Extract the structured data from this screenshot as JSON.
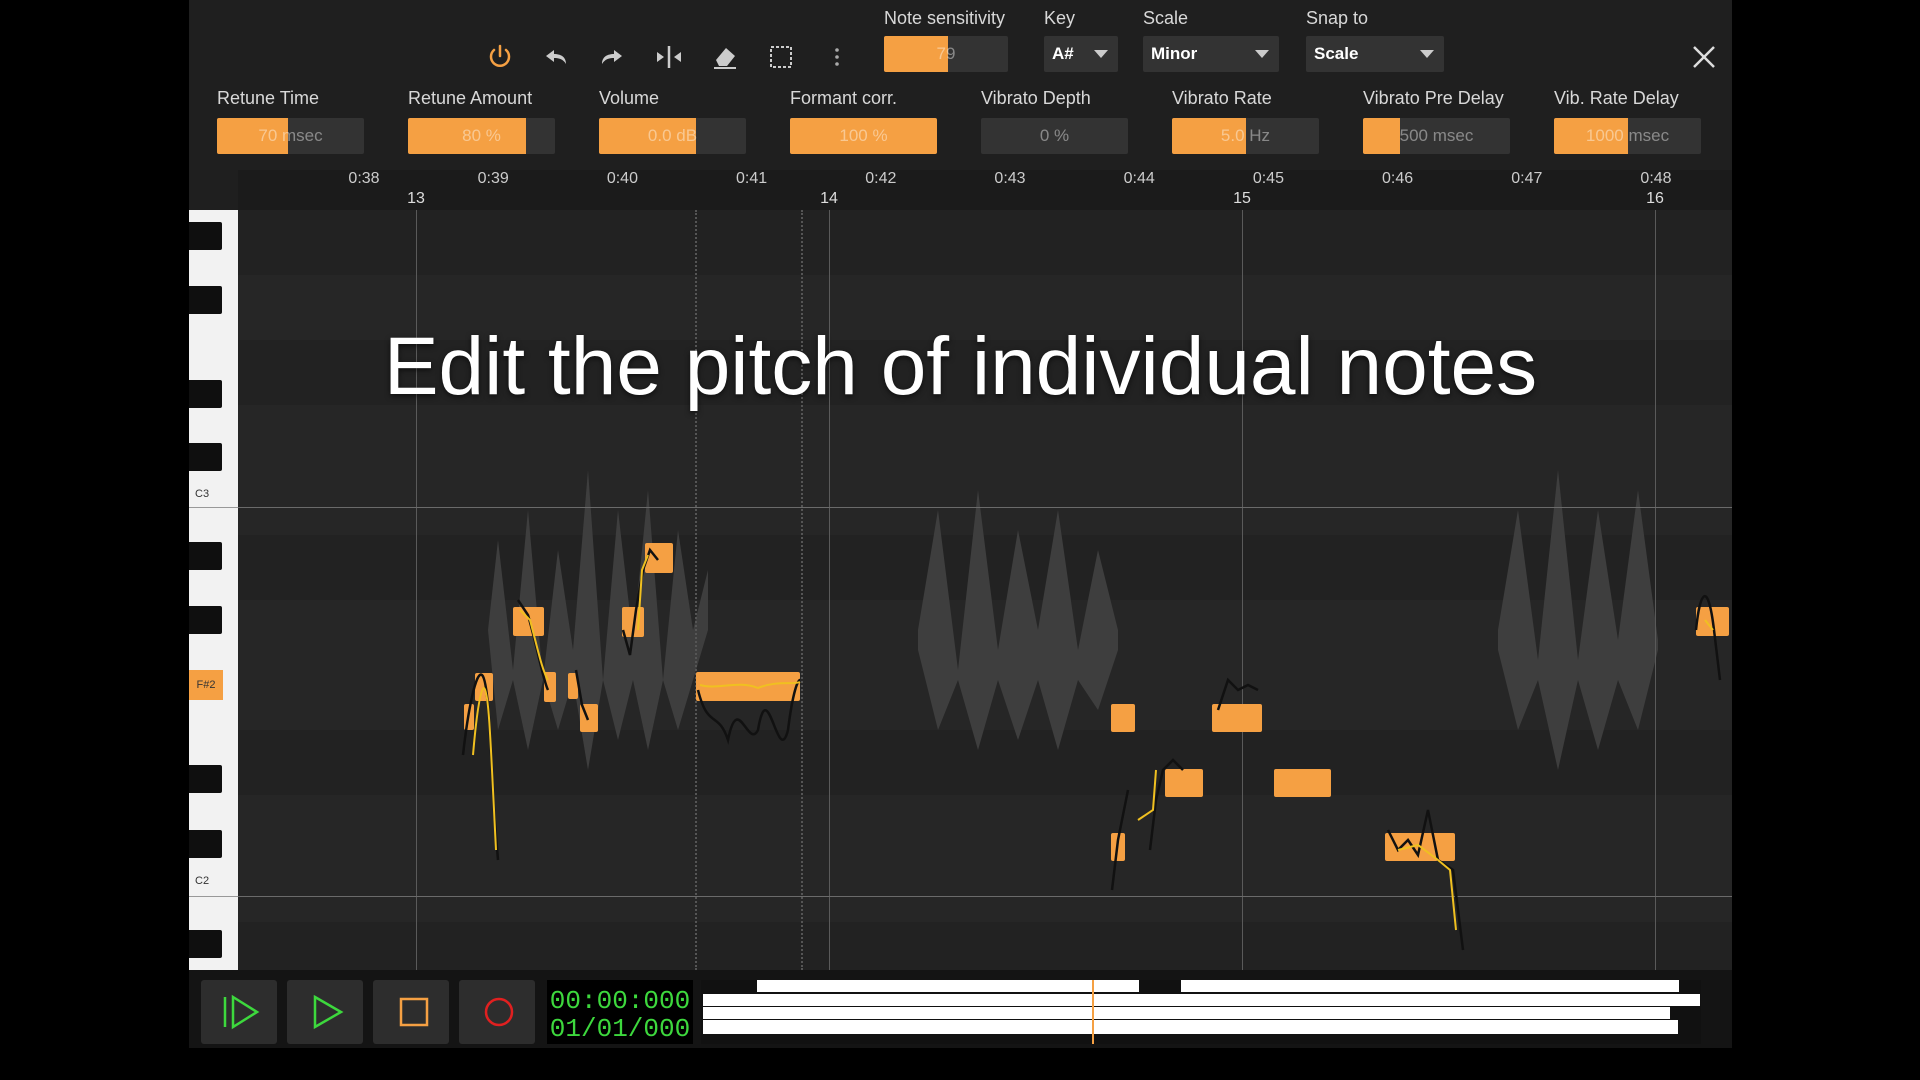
{
  "toolbar": {
    "icons": [
      "power-icon",
      "undo-icon",
      "redo-icon",
      "split-icon",
      "eraser-icon",
      "select-rect-icon",
      "more-icon"
    ],
    "note_sensitivity": {
      "label": "Note sensitivity",
      "value": "79",
      "level": 0.79
    },
    "key": {
      "label": "Key",
      "value": "A#"
    },
    "scale": {
      "label": "Scale",
      "value": "Minor"
    },
    "snap": {
      "label": "Snap to",
      "value": "Scale"
    },
    "accent_color": "#f5a043"
  },
  "params": [
    {
      "label": "Retune Time",
      "value": "70 msec",
      "level": 0.48
    },
    {
      "label": "Retune Amount",
      "value": "80 %",
      "level": 0.8
    },
    {
      "label": "Volume",
      "value": "0.0 dB",
      "level": 0.66
    },
    {
      "label": "Formant corr.",
      "value": "100 %",
      "level": 1.0
    },
    {
      "label": "Vibrato Depth",
      "value": "0 %",
      "level": 0.0
    },
    {
      "label": "Vibrato Rate",
      "value": "5.0 Hz",
      "level": 0.5
    },
    {
      "label": "Vibrato Pre Delay",
      "value": "500 msec",
      "level": 0.25
    },
    {
      "label": "Vib. Rate Delay",
      "value": "1000 msec",
      "level": 0.5
    }
  ],
  "timeline": {
    "times": [
      "0:38",
      "0:39",
      "0:40",
      "0:41",
      "0:42",
      "0:43",
      "0:44",
      "0:45",
      "0:46",
      "0:47",
      "0:48"
    ],
    "bars": [
      "13",
      "14",
      "15",
      "16"
    ]
  },
  "piano": {
    "c3": "C3",
    "fsharp2": "F#2",
    "c2": "C2"
  },
  "caption": "Edit the pitch of individual notes",
  "transport": {
    "timecode": "00:00:000",
    "bar_position": "01/01/000",
    "text_color": "#3dd83d"
  }
}
